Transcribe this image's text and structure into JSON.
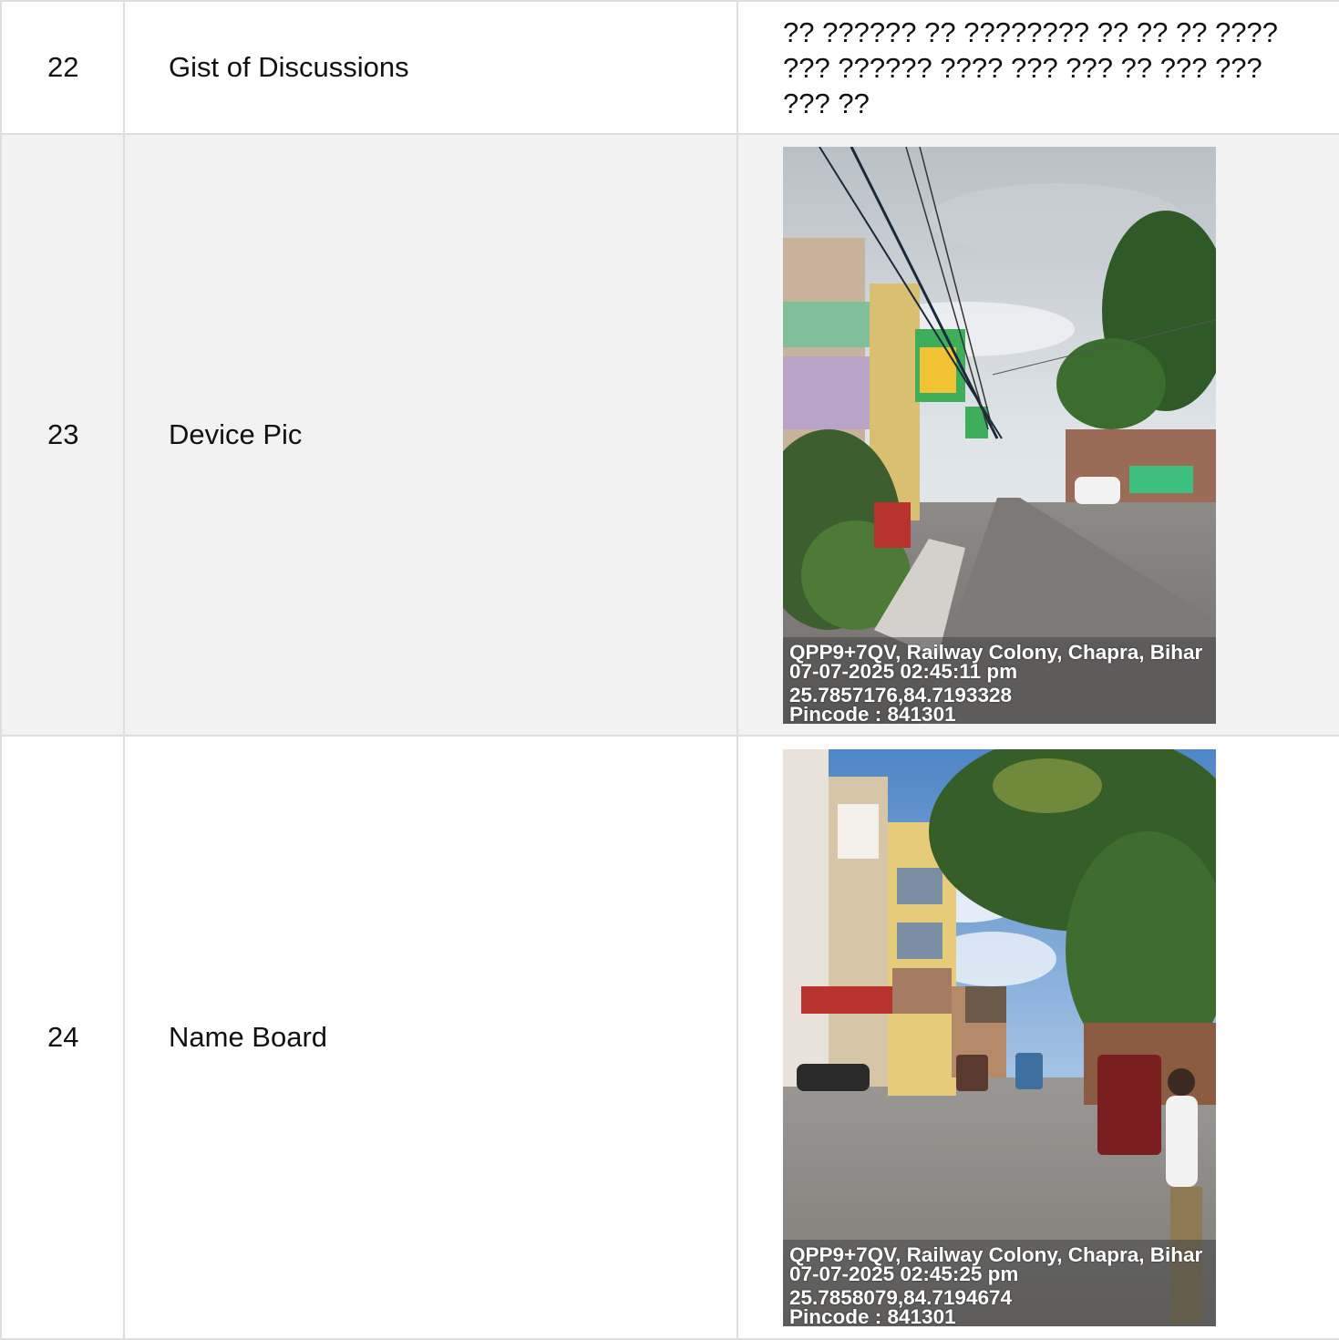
{
  "rows": [
    {
      "number": "22",
      "label": "Gist of Discussions",
      "value": "?? ?????? ?? ???????? ?? ?? ?? ???? ??? ?????? ???? ??? ??? ?? ??? ??? ??? ??"
    },
    {
      "number": "23",
      "label": "Device Pic",
      "photo": {
        "description": "street-scene-photo",
        "overlay": {
          "address": "QPP9+7QV, Railway Colony, Chapra, Bihar",
          "datetime": "07-07-2025 02:45:11 pm",
          "coordinates": "25.7857176,84.7193328",
          "pincode": "Pincode : 841301"
        }
      }
    },
    {
      "number": "24",
      "label": "Name Board",
      "photo": {
        "description": "street-scene-photo",
        "overlay": {
          "address": "QPP9+7QV, Railway Colony, Chapra, Bihar",
          "datetime": "07-07-2025 02:45:25 pm",
          "coordinates": "25.7858079,84.7194674",
          "pincode": "Pincode : 841301"
        }
      }
    }
  ],
  "colors": {
    "border": "#dedede",
    "alt_row": "#f2f2f2",
    "text": "#111111"
  }
}
